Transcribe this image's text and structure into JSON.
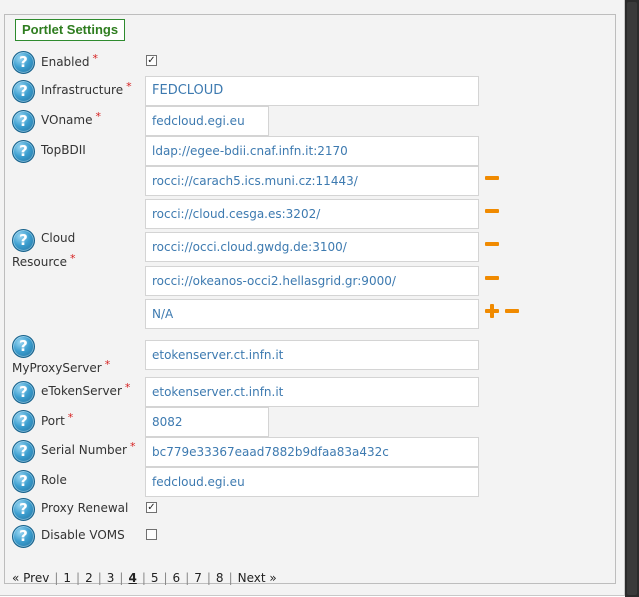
{
  "legend": "Portlet Settings",
  "fields": {
    "enabled": {
      "label": "Enabled",
      "required": "*",
      "checked": "✓"
    },
    "infrastructure": {
      "label": "Infrastructure",
      "required": "*",
      "value": "FEDCLOUD"
    },
    "voname": {
      "label": "VOname",
      "required": "*",
      "value": "fedcloud.egi.eu"
    },
    "topbdii": {
      "label": "TopBDII",
      "value": "ldap://egee-bdii.cnaf.infn.it:2170"
    },
    "cloud_resource": {
      "label_line1": "Cloud",
      "label_line2": "Resource",
      "required": "*",
      "values": [
        "rocci://carach5.ics.muni.cz:11443/",
        "rocci://cloud.cesga.es:3202/",
        "rocci://occi.cloud.gwdg.de:3100/",
        "rocci://okeanos-occi2.hellasgrid.gr:9000/",
        "N/A"
      ]
    },
    "myproxyserver": {
      "label": "MyProxyServer",
      "required": "*",
      "value": "etokenserver.ct.infn.it"
    },
    "etokenserver": {
      "label": "eTokenServer",
      "required": "*",
      "value": "etokenserver.ct.infn.it"
    },
    "port": {
      "label": "Port",
      "required": "*",
      "value": "8082"
    },
    "serial_number": {
      "label": "Serial Number",
      "required": "*",
      "value": "bc779e33367eaad7882b9dfaa83a432c"
    },
    "role": {
      "label": "Role",
      "value": "fedcloud.egi.eu"
    },
    "proxy_renewal": {
      "label": "Proxy Renewal",
      "checked": "✓"
    },
    "disable_voms": {
      "label": "Disable VOMS",
      "checked": ""
    }
  },
  "help_glyph": "?",
  "pagination": {
    "prev": "« Prev",
    "pages": [
      "1",
      "2",
      "3",
      "4",
      "5",
      "6",
      "7",
      "8"
    ],
    "current": "4",
    "next": "Next »"
  },
  "colors": {
    "legend": "#2e7d1f",
    "input_text": "#3d7ab0",
    "required": "#d61e1e",
    "action": "#f08a00",
    "help": "#3d9fd0"
  },
  "icons": {
    "help": "help-icon",
    "add": "plus-icon",
    "remove": "minus-icon"
  }
}
